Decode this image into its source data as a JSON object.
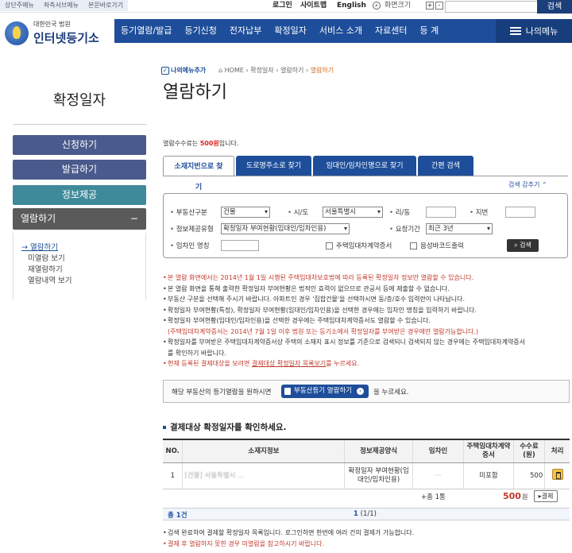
{
  "topbar": {
    "skip_links": [
      "상단주메뉴",
      "좌측서브메뉴",
      "본문바로가기"
    ],
    "login": "로그인",
    "sitemap": "사이트맵",
    "english": "English",
    "zoom_label": "화면크기",
    "zoom_in": "+",
    "zoom_out": "-",
    "search_button": "검색"
  },
  "header": {
    "logo_sub": "대한민국 법원",
    "logo_main": "인터넷등기소",
    "gnb": [
      "등기열람/발급",
      "등기신청",
      "전자납부",
      "확정일자",
      "서비스 소개",
      "자료센터",
      "등 계"
    ],
    "my_menu": "나의메뉴"
  },
  "sidebar": {
    "title": "확정일자",
    "buttons": [
      "신청하기",
      "발급하기",
      "정보제공"
    ],
    "open_section": "열람하기",
    "open_toggle": "−",
    "sub_items": [
      "열람하기",
      "미열람 보기",
      "재열람하기",
      "열람내역 보기"
    ]
  },
  "content": {
    "add_menu": "나의메뉴추가",
    "breadcrumb": [
      "HOME",
      "확정일자",
      "열람하기",
      "열람하기"
    ],
    "title": "열람하기",
    "fee_pre": "열람수수료는 ",
    "fee_amount": "500원",
    "fee_post": "입니다.",
    "tabs": [
      "소재지번으로 찾기",
      "도로명주소로 찾기",
      "임대인/임차인명으로 찾기",
      "간편 검색"
    ],
    "collapse": "검색 감추기 ⌃"
  },
  "form": {
    "property_type_label": "부동산구분",
    "property_type_value": "건물",
    "sido_label": "시/도",
    "sido_value": "서울특별시",
    "ri_label": "리/동",
    "jibun_label": "지번",
    "info_type_label": "정보제공유형",
    "info_type_value": "확정일자 부여현황(임대인/임차인용)",
    "period_label": "요청기간",
    "period_value": "최근 3년",
    "tenant_label": "임차인 명칭",
    "lease_check_label": "주택임대차계약증서",
    "barcode_check_label": "음성바코드출력",
    "search_button": "검색"
  },
  "notes": [
    {
      "text": "본 열람 화면에서는 2014년 1월 1일 시행된 주택임대차보호법에 따라 등록된 확정일자 정보만 열람할 수 있습니다.",
      "red": true
    },
    {
      "text": "본 열람 화면을 통해 출력한 확정일자 부여현황은 법적인 효력이 없으므로 관공서 등에 제출할 수 없습니다.",
      "red": false
    },
    {
      "text": "부동산 구분을 선택해 주시기 바랍니다. 아파트인 경우 '집합건물'을 선택하시면 동/층/호수 입력란이 나타납니다.",
      "red": false
    },
    {
      "text": "확정일자 부여현황(특정), 확정일자 부여현황(임대인/임차인용)을 선택한 경우에는 임차인 명칭을 입력하기 바랍니다.",
      "red": false
    },
    {
      "text": "확정일자 부여현황(임대인/임차인용)을 선택한 경우에는 주택임대차계약증서도 열람할 수 있습니다.",
      "red": false
    },
    {
      "text": "(주택임대차계약증서는 2014년 7월 1일 이후 법원 또는 등기소에서 확정일자를 부여받은 경우에만 열람가능합니다.)",
      "red": true,
      "indent": true
    },
    {
      "text": "확정일자를 부여받은 주택임대차계약증서상 주택의 소재지 표시 정보를 기준으로 검색되니 검색되지 않는 경우에는 주택임대차계약증서",
      "red": false
    },
    {
      "text": "를 확인하기 바랍니다.",
      "red": false,
      "indent": true
    }
  ],
  "note_link": {
    "pre": "현재 등록된 결제대상을 보려면 ",
    "link": "결제대상 확정일자 목록보기",
    "post": "를 누르세요."
  },
  "reg_box": {
    "pre": "해당 부동산의 등기열람을 원하시면",
    "button": "부동산등기 열람하기",
    "post": "을 누르세요."
  },
  "result": {
    "title": "결제대상 확정일자를 확인하세요.",
    "headers": [
      "NO.",
      "소재지정보",
      "정보제공양식",
      "임차인",
      "주택임대차계약증서",
      "수수료(원)",
      "처리"
    ],
    "rows": [
      {
        "no": "1",
        "address": "[건물] 서울특별시 ...",
        "form": "확정일자 부여현황(임대인/임차인용)",
        "tenant": "···",
        "contract": "미포함",
        "fee": "500"
      }
    ],
    "count_text": "총 1 건",
    "count_prefix": "+총 1통",
    "total_amount": "500",
    "won": "원",
    "pay_button": "결제"
  },
  "pager": {
    "total": "총 1건",
    "current": "1",
    "of": "(1/1)"
  },
  "bottom_notes": [
    {
      "text": "검색 완료하여 결제할 확정일자 목록입니다. 로그인하면 한번에 여러 건의 결제가 가능합니다.",
      "red": false
    },
    {
      "text": "결제 후 열람하지 못한 경우 미열람을 참고하시기 바랍니다.",
      "red": true
    }
  ]
}
